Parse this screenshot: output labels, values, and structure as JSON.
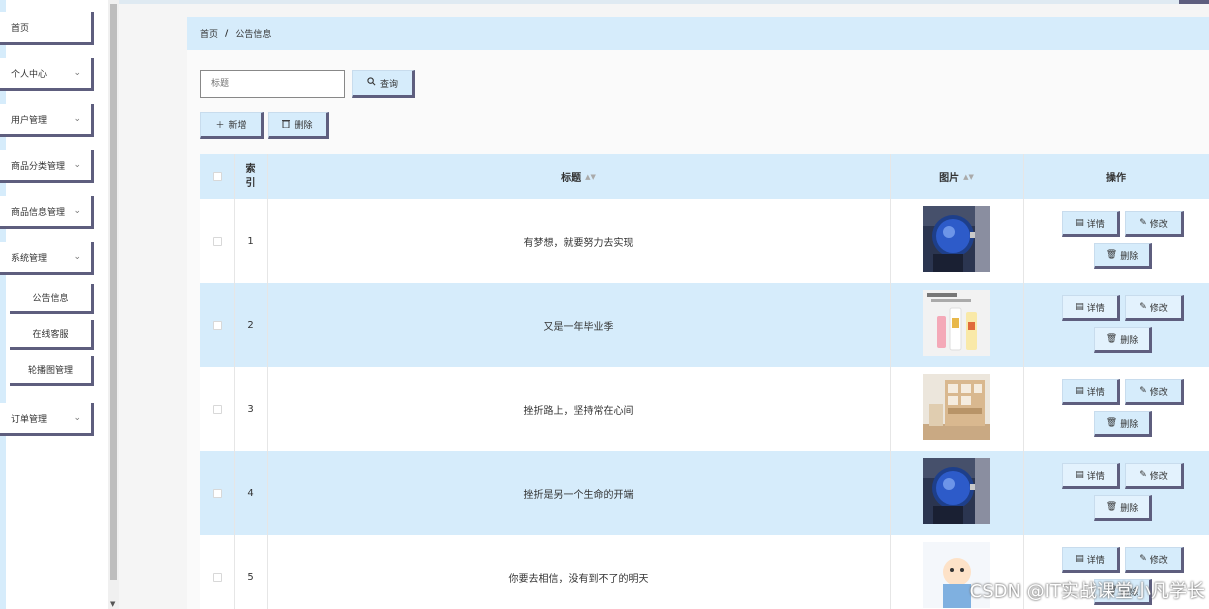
{
  "sidebar": {
    "items": [
      {
        "label": "首页",
        "chevron": ""
      },
      {
        "label": "个人中心",
        "chevron": "⌄"
      },
      {
        "label": "用户管理",
        "chevron": "⌄"
      },
      {
        "label": "商品分类管理",
        "chevron": "⌄"
      },
      {
        "label": "商品信息管理",
        "chevron": "⌄"
      },
      {
        "label": "系统管理",
        "chevron": "⌄"
      }
    ],
    "sub_items": [
      {
        "label": "公告信息"
      },
      {
        "label": "在线客服"
      },
      {
        "label": "轮播图管理"
      }
    ],
    "last_item": {
      "label": "订单管理",
      "chevron": "⌄"
    }
  },
  "breadcrumb": {
    "home": "首页",
    "separator": "/",
    "current": "公告信息"
  },
  "search": {
    "placeholder": "标题",
    "button_label": "查询"
  },
  "toolbar": {
    "add_label": "新增",
    "delete_label": "删除"
  },
  "table": {
    "headers": {
      "index": "索引",
      "title": "标题",
      "image": "图片",
      "actions": "操作"
    },
    "rows": [
      {
        "index": "1",
        "title": "有梦想，就要努力去实现",
        "image": "watch"
      },
      {
        "index": "2",
        "title": "又是一年毕业季",
        "image": "drinks"
      },
      {
        "index": "3",
        "title": "挫折路上，坚持常在心间",
        "image": "shelf"
      },
      {
        "index": "4",
        "title": "挫折是另一个生命的开端",
        "image": "watch"
      },
      {
        "index": "5",
        "title": "你要去相信，没有到不了的明天",
        "image": "cartoon"
      }
    ],
    "action_labels": {
      "detail": "详情",
      "edit": "修改",
      "delete": "删除"
    }
  },
  "colors": {
    "accent": "#d6ecfb",
    "border_dark": "#5e5e7e"
  },
  "watermark": "CSDN @IT实战课堂小凡学长"
}
